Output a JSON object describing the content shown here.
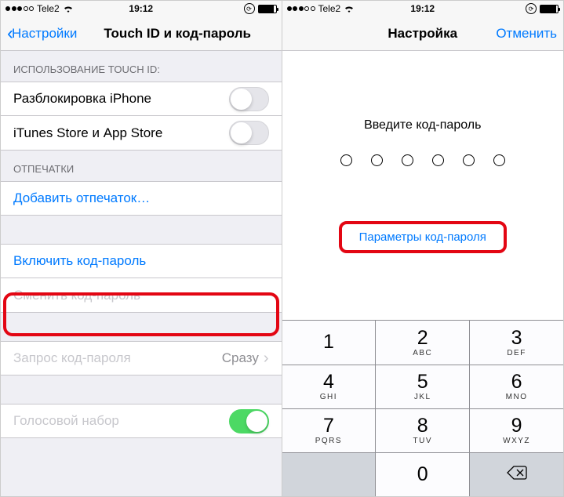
{
  "status": {
    "carrier": "Tele2",
    "time": "19:12"
  },
  "left": {
    "back": "Настройки",
    "title": "Touch ID и код-пароль",
    "section_touchid": "ИСПОЛЬЗОВАНИЕ TOUCH ID:",
    "unlock_iphone": "Разблокировка iPhone",
    "itunes": "iTunes Store и App Store",
    "section_fingerprints": "ОТПЕЧАТКИ",
    "add_fingerprint": "Добавить отпечаток…",
    "enable_passcode": "Включить код-пароль",
    "change_passcode": "Сменить код-пароль",
    "require_passcode": "Запрос код-пароля",
    "require_value": "Сразу",
    "voice_dial": "Голосовой набор"
  },
  "right": {
    "title": "Настройка",
    "cancel": "Отменить",
    "prompt": "Введите код-пароль",
    "options": "Параметры код-пароля",
    "keys": {
      "k1": {
        "n": "1",
        "l": ""
      },
      "k2": {
        "n": "2",
        "l": "ABC"
      },
      "k3": {
        "n": "3",
        "l": "DEF"
      },
      "k4": {
        "n": "4",
        "l": "GHI"
      },
      "k5": {
        "n": "5",
        "l": "JKL"
      },
      "k6": {
        "n": "6",
        "l": "MNO"
      },
      "k7": {
        "n": "7",
        "l": "PQRS"
      },
      "k8": {
        "n": "8",
        "l": "TUV"
      },
      "k9": {
        "n": "9",
        "l": "WXYZ"
      },
      "k0": {
        "n": "0",
        "l": ""
      }
    }
  }
}
